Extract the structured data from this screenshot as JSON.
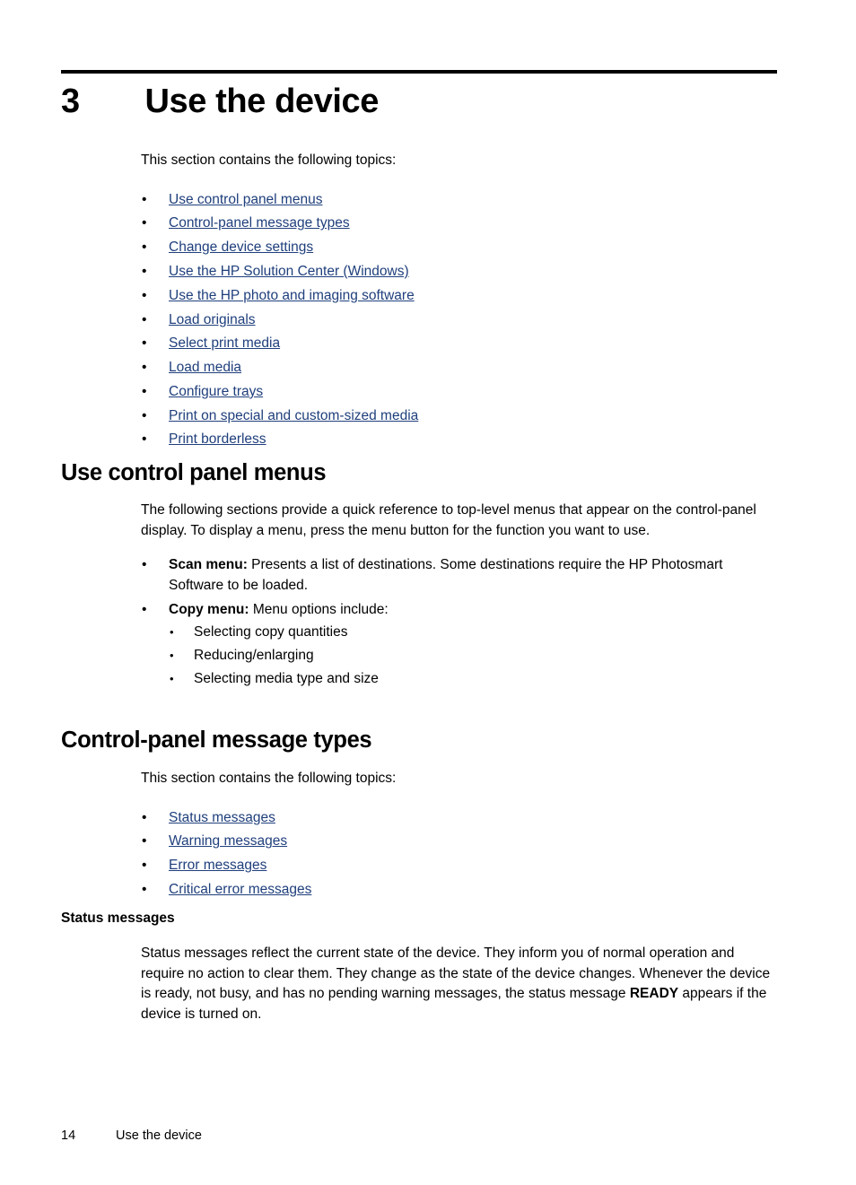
{
  "chapter": {
    "number": "3",
    "title": "Use the device"
  },
  "intro": {
    "lead": "This section contains the following topics:",
    "links": [
      "Use control panel menus",
      "Control-panel message types",
      "Change device settings",
      "Use the HP Solution Center (Windows)",
      "Use the HP photo and imaging software",
      "Load originals",
      "Select print media",
      "Load media",
      "Configure trays",
      "Print on special and custom-sized media",
      "Print borderless"
    ]
  },
  "section_menus": {
    "heading": "Use control panel menus",
    "paragraph": "The following sections provide a quick reference to top-level menus that appear on the control-panel display. To display a menu, press the menu button for the function you want to use.",
    "items": [
      {
        "label": "Scan menu:",
        "text": " Presents a list of destinations. Some destinations require the HP Photosmart Software to be loaded."
      },
      {
        "label": "Copy menu:",
        "text": " Menu options include:",
        "subitems": [
          "Selecting copy quantities",
          "Reducing/enlarging",
          "Selecting media type and size"
        ]
      }
    ]
  },
  "section_messages": {
    "heading": "Control-panel message types",
    "lead": "This section contains the following topics:",
    "links": [
      "Status messages",
      "Warning messages",
      "Error messages",
      "Critical error messages"
    ]
  },
  "section_status": {
    "heading": "Status messages",
    "text_before_bold": "Status messages reflect the current state of the device. They inform you of normal operation and require no action to clear them. They change as the state of the device changes. Whenever the device is ready, not busy, and has no pending warning messages, the status message ",
    "bold_term": "READY",
    "text_after_bold": " appears if the device is turned on."
  },
  "footer": {
    "page_number": "14",
    "title": "Use the device"
  },
  "bullet_glyph": "•",
  "colors": {
    "link": "#1F3F7C",
    "text": "#000000",
    "rule": "#000000"
  }
}
